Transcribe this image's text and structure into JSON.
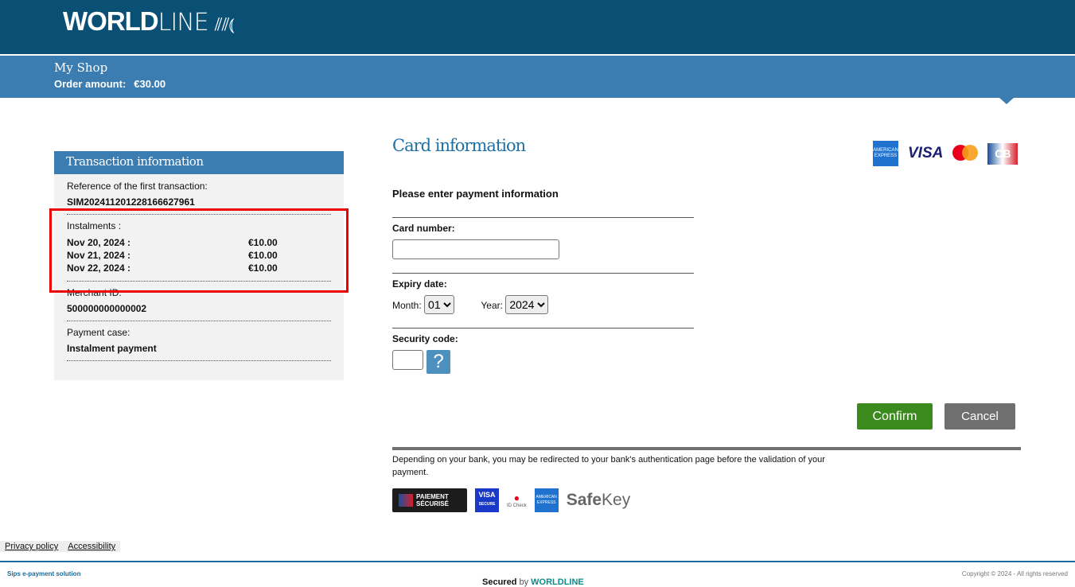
{
  "header": {
    "logo_bold": "WORLD",
    "logo_light": "LINE",
    "shop_name": "My Shop",
    "order_amount_label": "Order amount:",
    "order_amount": "€30.00"
  },
  "transaction": {
    "title": "Transaction information",
    "reference_label": "Reference of the first transaction:",
    "reference": "SIM202411201228166627961",
    "instalments_label": "Instalments :",
    "instalments": [
      {
        "date": "Nov 20, 2024 :",
        "amount": "€10.00"
      },
      {
        "date": "Nov 21, 2024 :",
        "amount": "€10.00"
      },
      {
        "date": "Nov 22, 2024 :",
        "amount": "€10.00"
      }
    ],
    "merchant_label": "Merchant ID:",
    "merchant_id": "500000000000002",
    "case_label": "Payment case:",
    "case": "Instalment payment"
  },
  "card": {
    "title": "Card information",
    "prompt": "Please enter payment information",
    "number_label": "Card number:",
    "number_value": "",
    "expiry_label": "Expiry date:",
    "month_label": "Month:",
    "month": "01",
    "year_label": "Year:",
    "year": "2024",
    "cvv_label": "Security code:",
    "cvv_value": "",
    "help": "?",
    "logos": {
      "amex": "AMERICAN EXPRESS",
      "visa": "VISA",
      "cb": "CB"
    }
  },
  "actions": {
    "confirm": "Confirm",
    "cancel": "Cancel"
  },
  "note": "Depending on your bank, you may be redirected to your bank's authentication page before the validation of your payment.",
  "badges": {
    "paiement": "PAIEMENT",
    "securise": "SÉCURISÉ",
    "visa": "VISA",
    "visa_secure": "SECURE",
    "id_check": "ID Check",
    "amex": "AMERICAN EXPRESS",
    "safe": "Safe",
    "key": "Key"
  },
  "footer": {
    "privacy": "Privacy policy",
    "accessibility": "Accessibility",
    "sips": "Sips e-payment solution",
    "copyright": "Copyright © 2024 - All rights reserved",
    "secured": "Secured",
    "by": "by",
    "worldline": "WORLDLINE"
  },
  "colors": {
    "header": "#0a4f74",
    "band": "#3b7db0",
    "confirm": "#3b8a1e",
    "cancel": "#6f6f6f",
    "highlight": "#e00000"
  }
}
